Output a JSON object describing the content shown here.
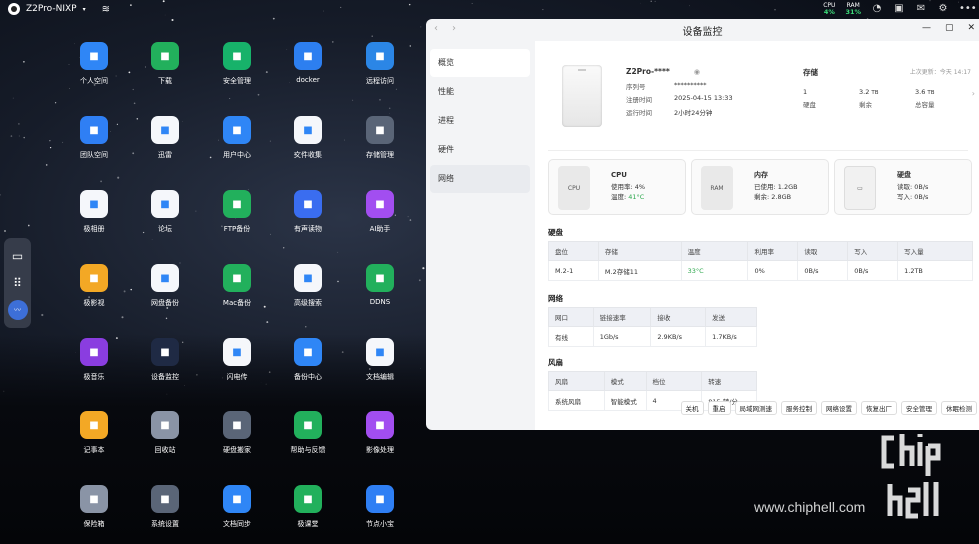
{
  "topbar": {
    "hostname": "Z2Pro-NIXP",
    "cpu_label": "CPU",
    "cpu_value": "4%",
    "ram_label": "RAM",
    "ram_value": "31%"
  },
  "apps": [
    {
      "label": "个人空间",
      "icon": "folder-icon",
      "color": "#2f86f6"
    },
    {
      "label": "下载",
      "icon": "download-icon",
      "color": "#22b05c"
    },
    {
      "label": "安全管理",
      "icon": "shield-icon",
      "color": "#17b26a"
    },
    {
      "label": "docker",
      "icon": "docker-icon",
      "color": "#2d7ff0"
    },
    {
      "label": "远程访问",
      "icon": "remote-icon",
      "color": "#2b86e6"
    },
    {
      "label": "团队空间",
      "icon": "team-icon",
      "color": "#2f7ff4"
    },
    {
      "label": "迅雷",
      "icon": "thunder-icon",
      "color": "#f5f7fb"
    },
    {
      "label": "用户中心",
      "icon": "user-icon",
      "color": "#2f86f6"
    },
    {
      "label": "文件收集",
      "icon": "file-collect-icon",
      "color": "#f5f7fb"
    },
    {
      "label": "存储管理",
      "icon": "storage-icon",
      "color": "#5a6577"
    },
    {
      "label": "极相册",
      "icon": "photos-icon",
      "color": "#f5f7fb"
    },
    {
      "label": "论坛",
      "icon": "forum-icon",
      "color": "#f5f7fb"
    },
    {
      "label": "FTP备份",
      "icon": "ftp-icon",
      "color": "#22b05c"
    },
    {
      "label": "有声读物",
      "icon": "audiobook-icon",
      "color": "#3a6df0"
    },
    {
      "label": "AI助手",
      "icon": "ai-icon",
      "color": "#a24ef0"
    },
    {
      "label": "极影视",
      "icon": "video-icon",
      "color": "#f3a825"
    },
    {
      "label": "网盘备份",
      "icon": "cloud-backup-icon",
      "color": "#f5f7fb"
    },
    {
      "label": "Mac备份",
      "icon": "mac-backup-icon",
      "color": "#22b05c"
    },
    {
      "label": "高级搜索",
      "icon": "search-icon",
      "color": "#f5f7fb"
    },
    {
      "label": "DDNS",
      "icon": "ddns-icon",
      "color": "#22b05c"
    },
    {
      "label": "极音乐",
      "icon": "music-icon",
      "color": "#8a3de0"
    },
    {
      "label": "设备监控",
      "icon": "monitor-icon",
      "color": "#1f2a44"
    },
    {
      "label": "闪电传",
      "icon": "flash-transfer-icon",
      "color": "#f5f7fb"
    },
    {
      "label": "备份中心",
      "icon": "backup-center-icon",
      "color": "#2f86f6"
    },
    {
      "label": "文档编辑",
      "icon": "doc-edit-icon",
      "color": "#f5f7fb"
    },
    {
      "label": "记事本",
      "icon": "notepad-icon",
      "color": "#f3a825"
    },
    {
      "label": "回收站",
      "icon": "trash-icon",
      "color": "#8a94a6"
    },
    {
      "label": "硬盘搬家",
      "icon": "disk-move-icon",
      "color": "#5a6577"
    },
    {
      "label": "帮助与反馈",
      "icon": "help-icon",
      "color": "#22b05c"
    },
    {
      "label": "影像处理",
      "icon": "image-process-icon",
      "color": "#a24ef0"
    },
    {
      "label": "保险箱",
      "icon": "safe-icon",
      "color": "#8a94a6"
    },
    {
      "label": "系统设置",
      "icon": "settings-icon",
      "color": "#5a6577"
    },
    {
      "label": "文档同步",
      "icon": "doc-sync-icon",
      "color": "#2f86f6"
    },
    {
      "label": "极课堂",
      "icon": "classroom-icon",
      "color": "#22b05c"
    },
    {
      "label": "节点小宝",
      "icon": "node-icon",
      "color": "#2f7ff4"
    }
  ],
  "window": {
    "title": "设备监控",
    "sidebar": [
      "概览",
      "性能",
      "进程",
      "硬件",
      "网络"
    ],
    "device": {
      "name": "Z2Pro-****",
      "serial_label": "序列号",
      "serial_value": "**********",
      "reg_label": "注册时间",
      "reg_value": "2025-04-15 13:33",
      "uptime_label": "运行时间",
      "uptime_value": "2小时24分钟"
    },
    "storage": {
      "title": "存储",
      "updated": "上次更新：今天 14:17",
      "disks": "1",
      "remaining": "3.2",
      "remaining_unit": "TB",
      "total": "3.6",
      "total_unit": "TB",
      "disks_label": "硬盘",
      "remaining_label": "剩余",
      "total_label": "总容量"
    },
    "cpu": {
      "title": "CPU",
      "icon_text": "CPU",
      "usage": "使用率: 4%",
      "temp_label": "温度: ",
      "temp_value": "41°C"
    },
    "memory": {
      "title": "内存",
      "icon_text": "RAM",
      "used": "已使用: 1.2GB",
      "free": "剩余: 2.8GB"
    },
    "disk": {
      "title": "硬盘",
      "read": "读取: 0B/s",
      "write": "写入: 0B/s"
    },
    "disk_table": {
      "title": "硬盘",
      "headers": [
        "盘位",
        "存储",
        "温度",
        "利用率",
        "读取",
        "写入",
        "写入量"
      ],
      "rows": [
        [
          "M.2-1",
          "M.2存储11",
          "33°C",
          "0%",
          "0B/s",
          "0B/s",
          "1.2TB"
        ]
      ]
    },
    "net_table": {
      "title": "网络",
      "headers": [
        "网口",
        "链接速率",
        "接收",
        "发送"
      ],
      "rows": [
        [
          "有线",
          "1Gb/s",
          "2.9KB/s",
          "1.7KB/s"
        ]
      ]
    },
    "fan_table": {
      "title": "风扇",
      "headers": [
        "风扇",
        "模式",
        "档位",
        "转速"
      ],
      "rows": [
        [
          "系统风扇",
          "智能模式",
          "4",
          "815 转/分"
        ]
      ]
    },
    "actions": [
      "关机",
      "重启",
      "局域网测速",
      "服务控制",
      "网络设置",
      "恢复出厂",
      "安全管理",
      "休眠检测"
    ]
  },
  "watermark": "www.chiphell.com"
}
